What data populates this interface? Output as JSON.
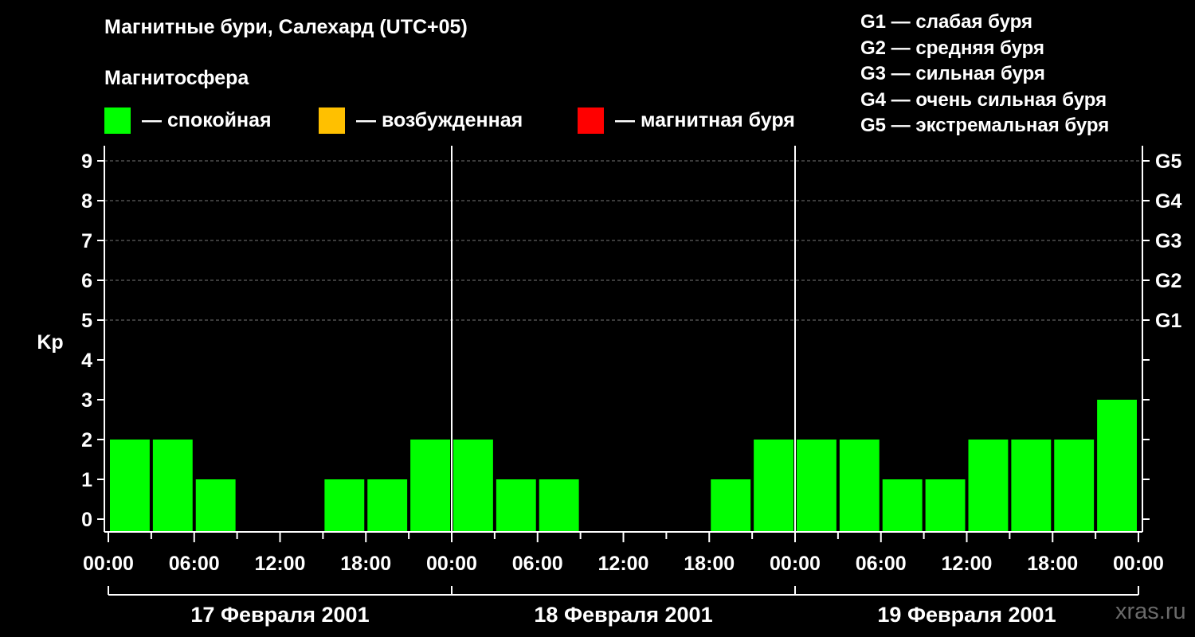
{
  "header": {
    "title": "Магнитные бури, Салехард (UTC+05)",
    "subtitle": "Магнитосфера"
  },
  "legend": [
    {
      "label": "— спокойная",
      "color": "#00ff00"
    },
    {
      "label": "— возбужденная",
      "color": "#ffc000"
    },
    {
      "label": "— магнитная буря",
      "color": "#ff0000"
    }
  ],
  "g_legend": [
    "G1 — слабая буря",
    "G2 — средняя буря",
    "G3 — сильная буря",
    "G4 — очень сильная буря",
    "G5 — экстремальная буря"
  ],
  "watermark": "xras.ru",
  "chart_data": {
    "type": "bar",
    "ylabel": "Kp",
    "ylim": [
      0,
      9
    ],
    "yticks": [
      0,
      1,
      2,
      3,
      4,
      5,
      6,
      7,
      8,
      9
    ],
    "right_ticks": [
      {
        "value": 5,
        "label": "G1"
      },
      {
        "value": 6,
        "label": "G2"
      },
      {
        "value": 7,
        "label": "G3"
      },
      {
        "value": 8,
        "label": "G4"
      },
      {
        "value": 9,
        "label": "G5"
      }
    ],
    "x_hours_range": [
      0,
      72
    ],
    "x_tick_labels": [
      "00:00",
      "06:00",
      "12:00",
      "18:00",
      "00:00",
      "06:00",
      "12:00",
      "18:00",
      "00:00",
      "06:00",
      "12:00",
      "18:00",
      "00:00"
    ],
    "days": [
      "17 Февраля 2001",
      "18 Февраля 2001",
      "19 Февраля 2001"
    ],
    "bar_color": "#00ff00",
    "categories": [
      "17.02 00:00",
      "17.02 03:00",
      "17.02 06:00",
      "17.02 09:00",
      "17.02 12:00",
      "17.02 15:00",
      "17.02 18:00",
      "17.02 21:00",
      "18.02 00:00",
      "18.02 03:00",
      "18.02 06:00",
      "18.02 09:00",
      "18.02 12:00",
      "18.02 15:00",
      "18.02 18:00",
      "18.02 21:00",
      "19.02 00:00",
      "19.02 03:00",
      "19.02 06:00",
      "19.02 09:00",
      "19.02 12:00",
      "19.02 15:00",
      "19.02 18:00",
      "19.02 21:00"
    ],
    "values": [
      2,
      2,
      1,
      0,
      0,
      1,
      1,
      2,
      2,
      1,
      1,
      0,
      0,
      0,
      1,
      2,
      2,
      2,
      1,
      1,
      2,
      2,
      2,
      3
    ],
    "grid_lines": "dashed at each Kp 5–9",
    "legend_position": "top"
  }
}
